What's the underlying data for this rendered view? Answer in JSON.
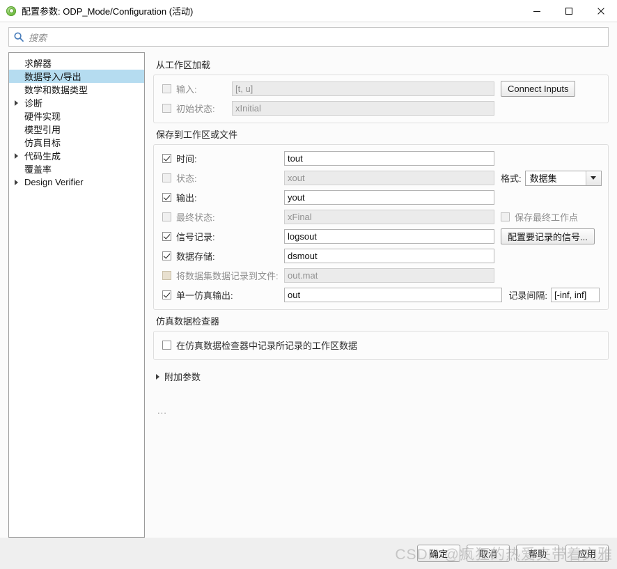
{
  "window": {
    "title": "配置参数: ODP_Mode/Configuration (活动)",
    "icon": "simulink-config-icon",
    "minimize_label": "最小化",
    "maximize_label": "最大化",
    "close_label": "关闭"
  },
  "search": {
    "icon": "search-icon",
    "placeholder": "搜索",
    "value": ""
  },
  "sidebar": {
    "items": [
      {
        "label": "求解器",
        "expandable": false,
        "selected": false
      },
      {
        "label": "数据导入/导出",
        "expandable": false,
        "selected": true
      },
      {
        "label": "数学和数据类型",
        "expandable": false,
        "selected": false
      },
      {
        "label": "诊断",
        "expandable": true,
        "selected": false
      },
      {
        "label": "硬件实现",
        "expandable": false,
        "selected": false
      },
      {
        "label": "模型引用",
        "expandable": false,
        "selected": false
      },
      {
        "label": "仿真目标",
        "expandable": false,
        "selected": false
      },
      {
        "label": "代码生成",
        "expandable": true,
        "selected": false
      },
      {
        "label": "覆盖率",
        "expandable": false,
        "selected": false
      },
      {
        "label": "Design Verifier",
        "expandable": true,
        "selected": false
      }
    ]
  },
  "load_section": {
    "title": "从工作区加载",
    "rows": [
      {
        "label": "输入:",
        "value": "[t, u]",
        "checked": false,
        "enabled": false
      },
      {
        "label": "初始状态:",
        "value": "xInitial",
        "checked": false,
        "enabled": false
      }
    ],
    "connect_inputs_button": "Connect Inputs"
  },
  "save_section": {
    "title": "保存到工作区或文件",
    "rows": [
      {
        "label": "时间:",
        "value": "tout",
        "checked": true,
        "enabled": true
      },
      {
        "label": "状态:",
        "value": "xout",
        "checked": false,
        "enabled": false
      },
      {
        "label": "输出:",
        "value": "yout",
        "checked": true,
        "enabled": true
      },
      {
        "label": "最终状态:",
        "value": "xFinal",
        "checked": false,
        "enabled": false
      },
      {
        "label": "信号记录:",
        "value": "logsout",
        "checked": true,
        "enabled": true
      },
      {
        "label": "数据存储:",
        "value": "dsmout",
        "checked": true,
        "enabled": true
      },
      {
        "label": "将数据集数据记录到文件:",
        "value": "out.mat",
        "checked": false,
        "enabled": false
      },
      {
        "label": "单一仿真输出:",
        "value": "out",
        "checked": true,
        "enabled": true
      }
    ],
    "format_label": "格式:",
    "format_value": "数据集",
    "save_final_op_label": "保存最终工作点",
    "save_final_op_checked": false,
    "configure_signals_button": "配置要记录的信号...",
    "interval_label": "记录间隔:",
    "interval_value": "[-inf, inf]"
  },
  "inspector_section": {
    "title": "仿真数据检查器",
    "checkbox_label": "在仿真数据检查器中记录所记录的工作区数据",
    "checked": false
  },
  "extra_params": {
    "label": "附加参数",
    "expanded": false
  },
  "overflow_indicator": "...",
  "footer": {
    "ok": "确定",
    "cancel": "取消",
    "help": "帮助",
    "apply": "应用",
    "watermark": "CSDN @疯狂的热爱夹带着文雅"
  },
  "colors": {
    "selection": "#b5dcf0",
    "accent_icon": "#4a7ebb",
    "titlebar_bg": "#ffffff",
    "panel_bg": "#fbfbfb",
    "footer_bg": "#efefef"
  }
}
